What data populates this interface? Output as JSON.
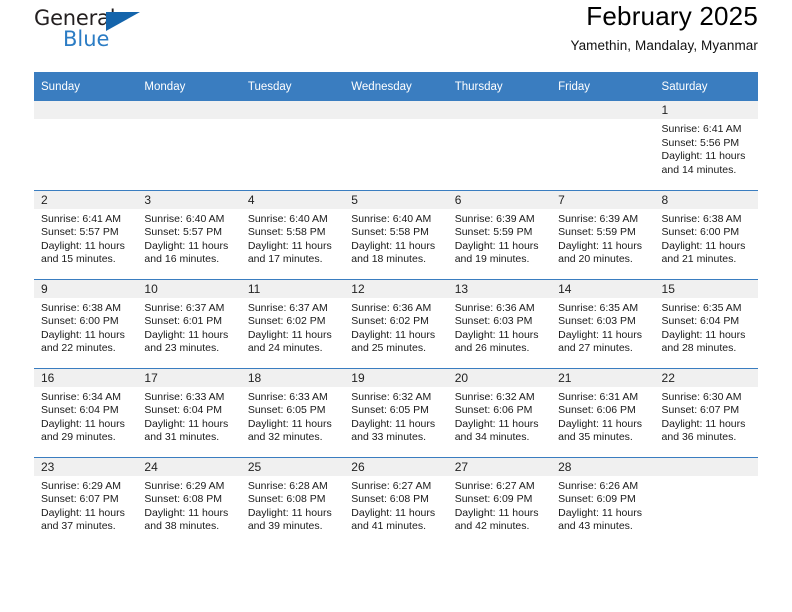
{
  "brand": {
    "name_part1": "General",
    "name_part2": "Blue",
    "accent_color": "#2b7cc4",
    "triangle_color": "#1464ab"
  },
  "header": {
    "title": "February 2025",
    "subtitle": "Yamethin, Mandalay, Myanmar"
  },
  "calendar": {
    "header_bg": "#3a7dc0",
    "header_text_color": "#ffffff",
    "daynum_bg": "#f0f0f0",
    "weekdays": [
      "Sunday",
      "Monday",
      "Tuesday",
      "Wednesday",
      "Thursday",
      "Friday",
      "Saturday"
    ],
    "weeks": [
      [
        {
          "day": "",
          "lines": []
        },
        {
          "day": "",
          "lines": []
        },
        {
          "day": "",
          "lines": []
        },
        {
          "day": "",
          "lines": []
        },
        {
          "day": "",
          "lines": []
        },
        {
          "day": "",
          "lines": []
        },
        {
          "day": "1",
          "lines": [
            "Sunrise: 6:41 AM",
            "Sunset: 5:56 PM",
            "Daylight: 11 hours",
            "and 14 minutes."
          ]
        }
      ],
      [
        {
          "day": "2",
          "lines": [
            "Sunrise: 6:41 AM",
            "Sunset: 5:57 PM",
            "Daylight: 11 hours",
            "and 15 minutes."
          ]
        },
        {
          "day": "3",
          "lines": [
            "Sunrise: 6:40 AM",
            "Sunset: 5:57 PM",
            "Daylight: 11 hours",
            "and 16 minutes."
          ]
        },
        {
          "day": "4",
          "lines": [
            "Sunrise: 6:40 AM",
            "Sunset: 5:58 PM",
            "Daylight: 11 hours",
            "and 17 minutes."
          ]
        },
        {
          "day": "5",
          "lines": [
            "Sunrise: 6:40 AM",
            "Sunset: 5:58 PM",
            "Daylight: 11 hours",
            "and 18 minutes."
          ]
        },
        {
          "day": "6",
          "lines": [
            "Sunrise: 6:39 AM",
            "Sunset: 5:59 PM",
            "Daylight: 11 hours",
            "and 19 minutes."
          ]
        },
        {
          "day": "7",
          "lines": [
            "Sunrise: 6:39 AM",
            "Sunset: 5:59 PM",
            "Daylight: 11 hours",
            "and 20 minutes."
          ]
        },
        {
          "day": "8",
          "lines": [
            "Sunrise: 6:38 AM",
            "Sunset: 6:00 PM",
            "Daylight: 11 hours",
            "and 21 minutes."
          ]
        }
      ],
      [
        {
          "day": "9",
          "lines": [
            "Sunrise: 6:38 AM",
            "Sunset: 6:00 PM",
            "Daylight: 11 hours",
            "and 22 minutes."
          ]
        },
        {
          "day": "10",
          "lines": [
            "Sunrise: 6:37 AM",
            "Sunset: 6:01 PM",
            "Daylight: 11 hours",
            "and 23 minutes."
          ]
        },
        {
          "day": "11",
          "lines": [
            "Sunrise: 6:37 AM",
            "Sunset: 6:02 PM",
            "Daylight: 11 hours",
            "and 24 minutes."
          ]
        },
        {
          "day": "12",
          "lines": [
            "Sunrise: 6:36 AM",
            "Sunset: 6:02 PM",
            "Daylight: 11 hours",
            "and 25 minutes."
          ]
        },
        {
          "day": "13",
          "lines": [
            "Sunrise: 6:36 AM",
            "Sunset: 6:03 PM",
            "Daylight: 11 hours",
            "and 26 minutes."
          ]
        },
        {
          "day": "14",
          "lines": [
            "Sunrise: 6:35 AM",
            "Sunset: 6:03 PM",
            "Daylight: 11 hours",
            "and 27 minutes."
          ]
        },
        {
          "day": "15",
          "lines": [
            "Sunrise: 6:35 AM",
            "Sunset: 6:04 PM",
            "Daylight: 11 hours",
            "and 28 minutes."
          ]
        }
      ],
      [
        {
          "day": "16",
          "lines": [
            "Sunrise: 6:34 AM",
            "Sunset: 6:04 PM",
            "Daylight: 11 hours",
            "and 29 minutes."
          ]
        },
        {
          "day": "17",
          "lines": [
            "Sunrise: 6:33 AM",
            "Sunset: 6:04 PM",
            "Daylight: 11 hours",
            "and 31 minutes."
          ]
        },
        {
          "day": "18",
          "lines": [
            "Sunrise: 6:33 AM",
            "Sunset: 6:05 PM",
            "Daylight: 11 hours",
            "and 32 minutes."
          ]
        },
        {
          "day": "19",
          "lines": [
            "Sunrise: 6:32 AM",
            "Sunset: 6:05 PM",
            "Daylight: 11 hours",
            "and 33 minutes."
          ]
        },
        {
          "day": "20",
          "lines": [
            "Sunrise: 6:32 AM",
            "Sunset: 6:06 PM",
            "Daylight: 11 hours",
            "and 34 minutes."
          ]
        },
        {
          "day": "21",
          "lines": [
            "Sunrise: 6:31 AM",
            "Sunset: 6:06 PM",
            "Daylight: 11 hours",
            "and 35 minutes."
          ]
        },
        {
          "day": "22",
          "lines": [
            "Sunrise: 6:30 AM",
            "Sunset: 6:07 PM",
            "Daylight: 11 hours",
            "and 36 minutes."
          ]
        }
      ],
      [
        {
          "day": "23",
          "lines": [
            "Sunrise: 6:29 AM",
            "Sunset: 6:07 PM",
            "Daylight: 11 hours",
            "and 37 minutes."
          ]
        },
        {
          "day": "24",
          "lines": [
            "Sunrise: 6:29 AM",
            "Sunset: 6:08 PM",
            "Daylight: 11 hours",
            "and 38 minutes."
          ]
        },
        {
          "day": "25",
          "lines": [
            "Sunrise: 6:28 AM",
            "Sunset: 6:08 PM",
            "Daylight: 11 hours",
            "and 39 minutes."
          ]
        },
        {
          "day": "26",
          "lines": [
            "Sunrise: 6:27 AM",
            "Sunset: 6:08 PM",
            "Daylight: 11 hours",
            "and 41 minutes."
          ]
        },
        {
          "day": "27",
          "lines": [
            "Sunrise: 6:27 AM",
            "Sunset: 6:09 PM",
            "Daylight: 11 hours",
            "and 42 minutes."
          ]
        },
        {
          "day": "28",
          "lines": [
            "Sunrise: 6:26 AM",
            "Sunset: 6:09 PM",
            "Daylight: 11 hours",
            "and 43 minutes."
          ]
        },
        {
          "day": "",
          "lines": []
        }
      ]
    ]
  }
}
